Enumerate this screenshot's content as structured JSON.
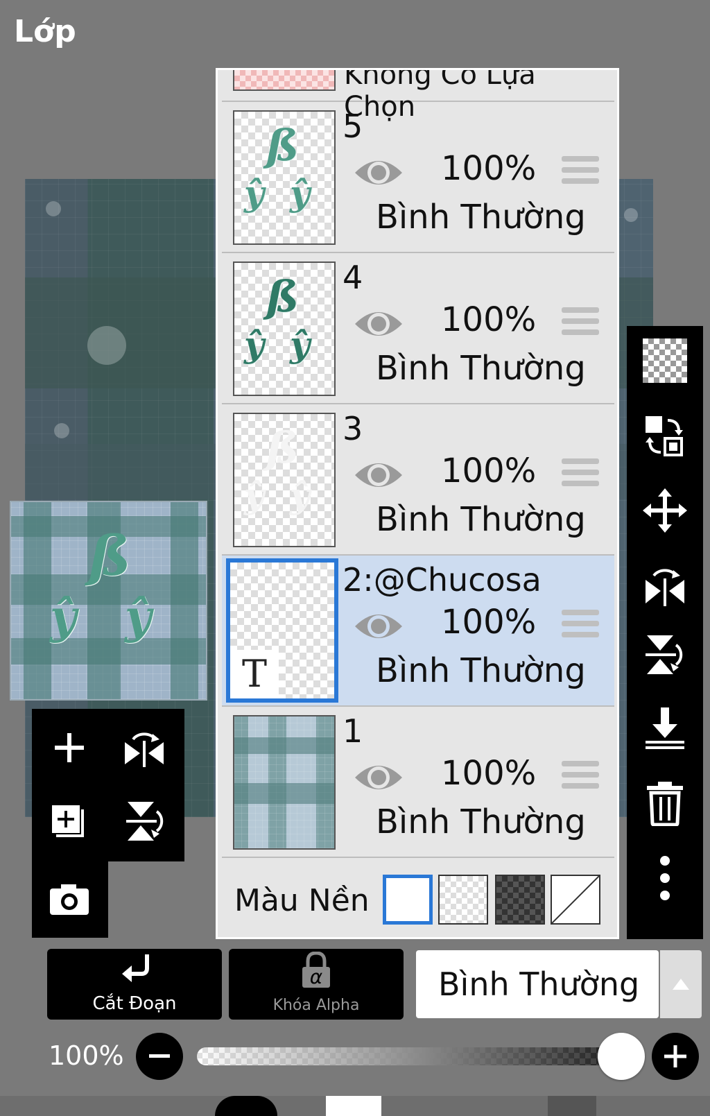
{
  "header": {
    "title": "Lớp"
  },
  "layers_panel": {
    "no_selection_label": "Không Có Lựa Chọn",
    "layers": [
      {
        "name": "5",
        "opacity": "100%",
        "blend": "Bình Thường",
        "selected": false
      },
      {
        "name": "4",
        "opacity": "100%",
        "blend": "Bình Thường",
        "selected": false
      },
      {
        "name": "3",
        "opacity": "100%",
        "blend": "Bình Thường",
        "selected": false
      },
      {
        "name": "2:@Chucosa",
        "opacity": "100%",
        "blend": "Bình Thường",
        "selected": true,
        "thumb_glyph": "T"
      },
      {
        "name": "1",
        "opacity": "100%",
        "blend": "Bình Thường",
        "selected": false
      }
    ],
    "background": {
      "label": "Màu Nền",
      "selected": "white"
    }
  },
  "bottom_bar": {
    "clip_label": "Cắt Đoạn",
    "alpha_lock_label": "Khóa Alpha",
    "alpha_lock_glyph": "α",
    "blend_mode": "Bình Thường",
    "opacity_value": "100%"
  },
  "colors": {
    "selection": "#2a78d6",
    "selected_row": "#cddcf0",
    "panel": "#e6e6e6"
  },
  "icons": {
    "left_tools": [
      "plus-icon",
      "flip-horizontal-icon",
      "add-layer-icon",
      "flip-vertical-icon",
      "camera-icon"
    ],
    "right_tools": [
      "transparency-icon",
      "swap-layers-icon",
      "move-icon",
      "flip-horizontal-icon",
      "flip-vertical-icon",
      "merge-down-icon",
      "trash-icon",
      "more-icon"
    ]
  }
}
